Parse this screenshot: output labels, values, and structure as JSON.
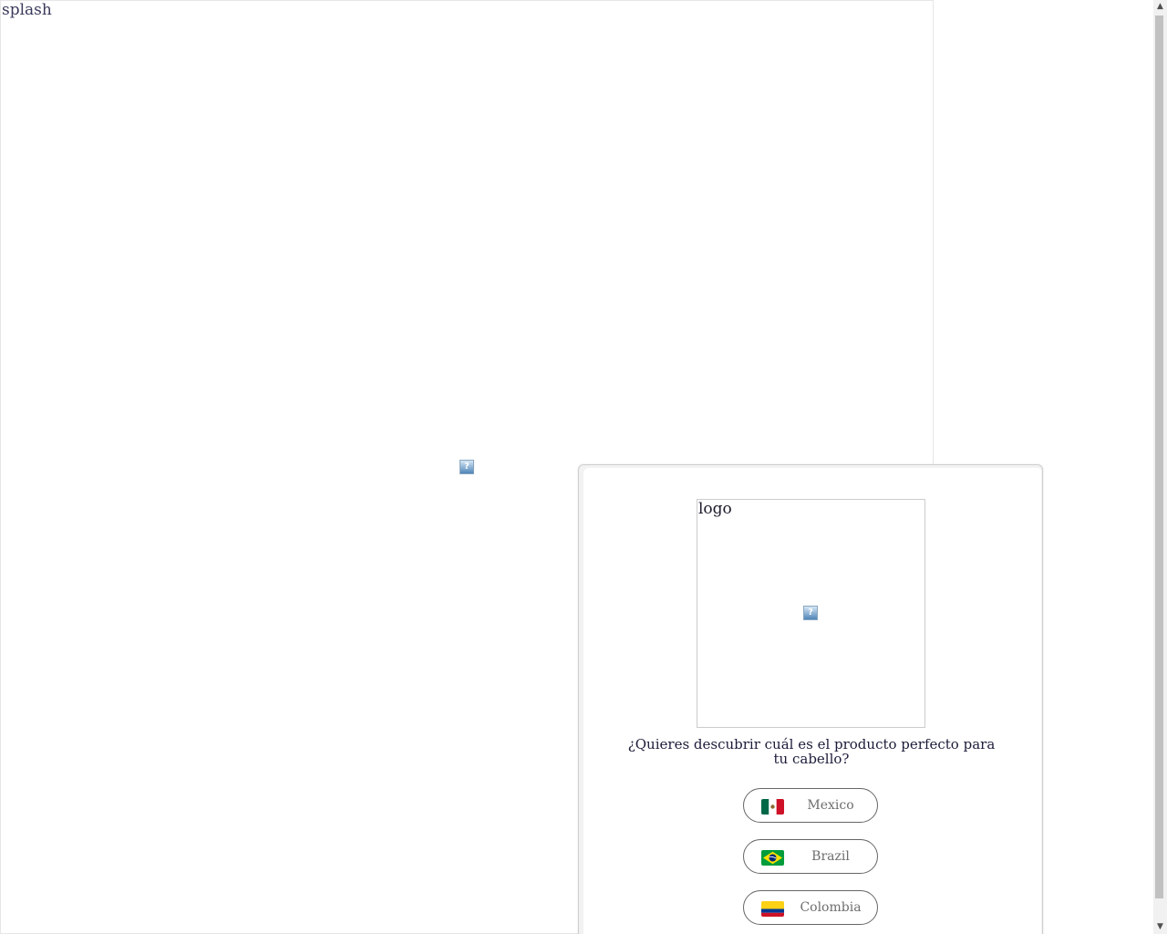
{
  "splash": {
    "alt": "splash",
    "broken_icon": "broken-image-icon"
  },
  "modal": {
    "logo_alt": "logo",
    "logo_broken_icon": "broken-image-icon",
    "prompt": "¿Quieres descubrir cuál es el producto perfecto para tu cabello?",
    "countries": [
      {
        "label": "Mexico",
        "icon": "mexico-flag-icon",
        "colors": [
          "#006847",
          "#ffffff",
          "#ce1126"
        ]
      },
      {
        "label": "Brazil",
        "icon": "brazil-flag-icon",
        "colors": [
          "#009c3b",
          "#ffdf00",
          "#002776"
        ]
      },
      {
        "label": "Colombia",
        "icon": "colombia-flag-icon",
        "colors": [
          "#fcd116",
          "#003893",
          "#ce1126"
        ]
      }
    ]
  },
  "scrollbar": {
    "up_icon": "scroll-up-arrow-icon",
    "down_icon": "scroll-down-arrow-icon"
  }
}
